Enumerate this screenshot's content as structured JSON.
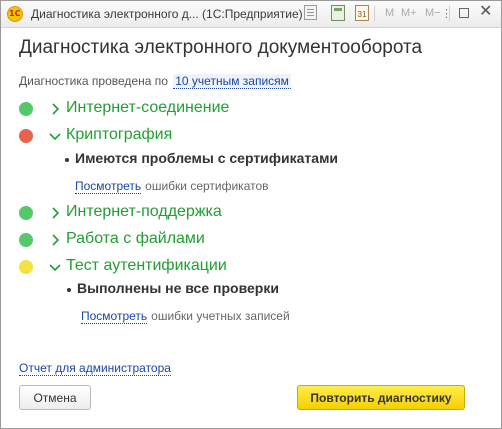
{
  "window": {
    "title": "Диагностика электронного д... (1С:Предприятие)",
    "toolbar": {
      "m": "M",
      "mplus": "M+",
      "mminus": "M−"
    }
  },
  "heading": "Диагностика электронного документооборота",
  "diagnostics": {
    "prefix": "Диагностика проведена по",
    "link": "10 учетным записям"
  },
  "checks": [
    {
      "label": "Интернет-соединение",
      "status": "ok",
      "color": "#54c96a",
      "expanded": false
    },
    {
      "label": "Криптография",
      "status": "error",
      "color": "#e8634d",
      "expanded": true,
      "detail": "Имеются проблемы с сертификатами",
      "link": "Посмотреть",
      "link_suffix": "ошибки сертификатов"
    },
    {
      "label": "Интернет-поддержка",
      "status": "ok",
      "color": "#54c96a",
      "expanded": false
    },
    {
      "label": "Работа с файлами",
      "status": "ok",
      "color": "#54c96a",
      "expanded": false
    },
    {
      "label": "Тест аутентификации",
      "status": "warning",
      "color": "#f2e242",
      "expanded": true,
      "detail": "Выполнены не все проверки",
      "link": "Посмотреть",
      "link_suffix": "ошибки учетных записей"
    }
  ],
  "footer": {
    "report_link": "Отчет для администратора",
    "cancel_label": "Отмена",
    "retry_label": "Повторить диагностику"
  }
}
